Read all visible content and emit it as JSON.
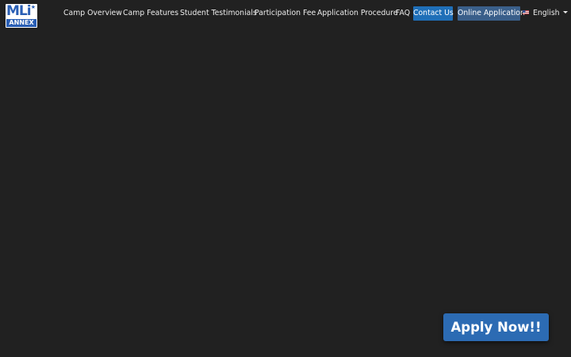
{
  "logo": {
    "top_text": "MLi",
    "bottom_text": "ANNEX",
    "star": "★",
    "color": "#2a5fb5"
  },
  "nav": {
    "items": [
      {
        "label": "Camp Overview"
      },
      {
        "label": "Camp Features"
      },
      {
        "label": "Student Testimonials"
      },
      {
        "label": "Participation Fee"
      },
      {
        "label": "Application Procedure"
      },
      {
        "label": "FAQ"
      }
    ],
    "contact_label": "Contact Us",
    "online_label": "Online Application",
    "language": {
      "label": "English",
      "flag_icon": "us-flag-icon",
      "caret_icon": "caret-down-icon"
    }
  },
  "cta": {
    "label": "Apply Now!!",
    "color": "#2c6bb3"
  },
  "colors": {
    "background": "#212121",
    "contact_bg": "#1f6fb8",
    "online_bg": "#3a5f8a"
  }
}
